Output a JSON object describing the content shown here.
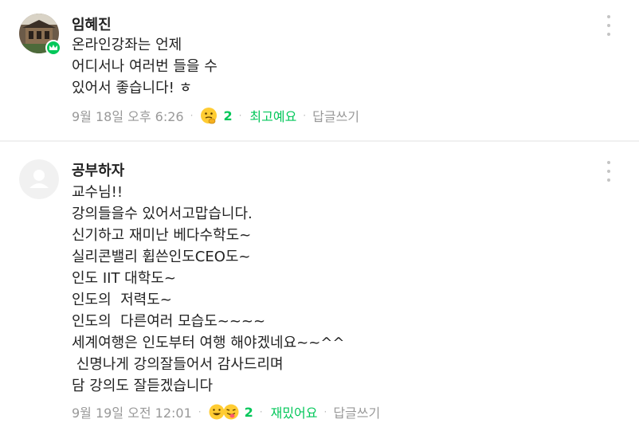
{
  "comments": [
    {
      "author": "임혜진",
      "body": "온라인강좌는 언제\n어디서나 여러번 들을 수\n있어서 좋습니다! ㅎ",
      "date": "9월 18일 오후 6:26",
      "reaction_icons": [
        "thinking-face-icon"
      ],
      "reaction_count": "2",
      "reaction_label": "최고예요",
      "reply_label": "답글쓰기",
      "has_manager_badge": true
    },
    {
      "author": "공부하자",
      "body": "교수님!!\n강의들을수 있어서고맙습니다.\n신기하고 재미난 베다수학도~\n실리콘밸리 휩쓴인도CEO도~\n인도 IIT 대학도~\n인도의  저력도~\n인도의  다른여러 모습도~~~~\n세계여행은 인도부터 여행 해야겠네요~~^^\n 신명나게 강의잘들어서 감사드리며\n담 강의도 잘듣겠습니다",
      "date": "9월 19일 오전 12:01",
      "reaction_icons": [
        "grinning-face-icon",
        "tongue-wink-face-icon"
      ],
      "reaction_count": "2",
      "reaction_label": "재밌어요",
      "reply_label": "답글쓰기",
      "has_manager_badge": false
    }
  ],
  "colors": {
    "accent": "#03c75a",
    "meta": "#999999",
    "divider": "#f0f0f0"
  }
}
